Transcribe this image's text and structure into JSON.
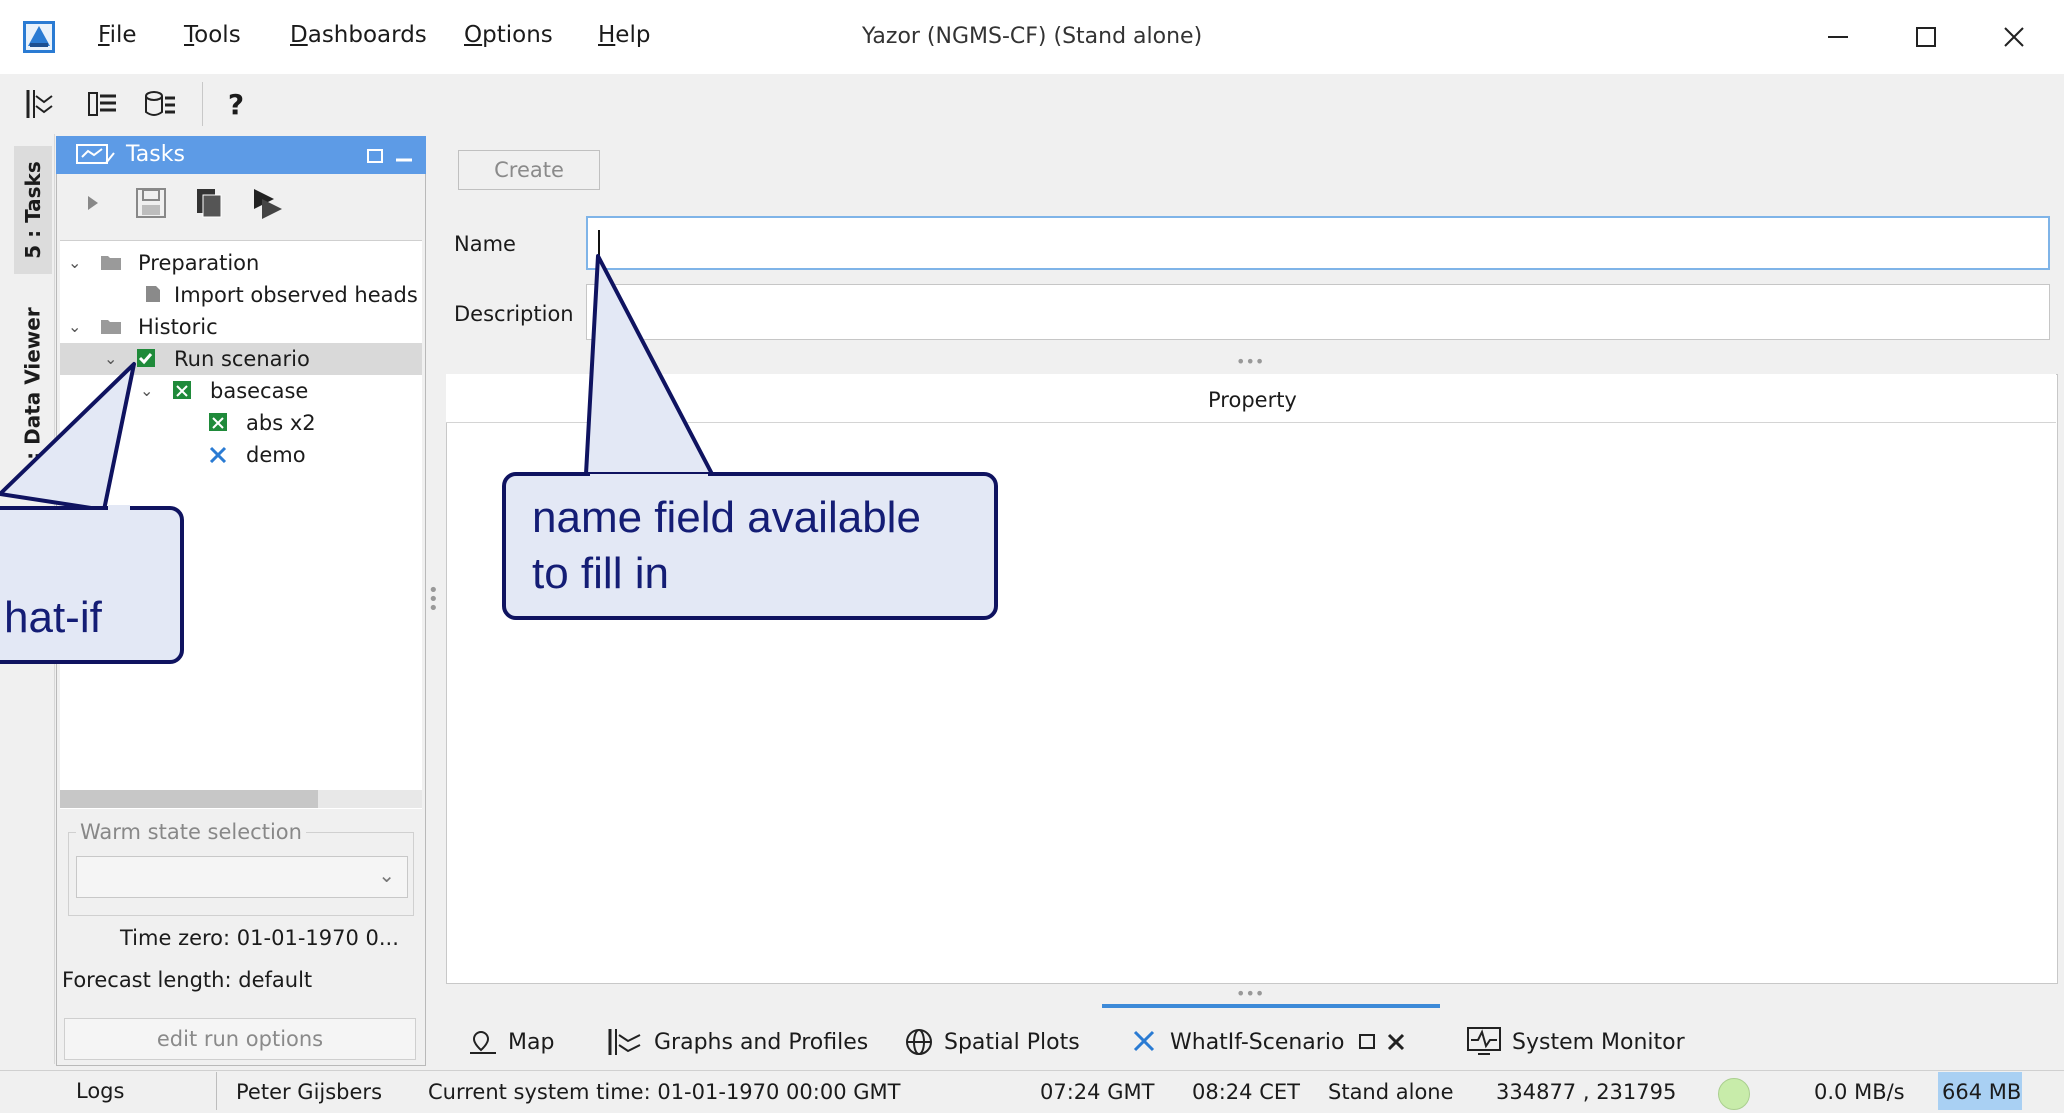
{
  "window": {
    "title": "Yazor (NGMS-CF)  (Stand alone)",
    "menu": [
      "File",
      "Tools",
      "Dashboards",
      "Options",
      "Help"
    ],
    "menu_underlines": [
      "F",
      "T",
      "D",
      "O",
      "H"
    ],
    "controls": [
      "minimize-icon",
      "maximize-icon",
      "close-icon"
    ]
  },
  "toolbar": {
    "help_label": "?"
  },
  "side_tabs": [
    "5 : Tasks",
    "6 : Data Viewer"
  ],
  "tasks": {
    "title": "Tasks",
    "tree": [
      {
        "label": "Preparation",
        "level": 0,
        "expanded": true,
        "icon": "folder-icon"
      },
      {
        "label": "Import observed heads",
        "level": 1,
        "icon": "document-icon"
      },
      {
        "label": "Historic",
        "level": 0,
        "expanded": true,
        "icon": "folder-icon"
      },
      {
        "label": "Run scenario",
        "level": 1,
        "expanded": true,
        "icon": "checkbox-icon",
        "selected": true
      },
      {
        "label": "basecase",
        "level": 2,
        "expanded": true,
        "icon": "scenario-icon"
      },
      {
        "label": "abs x2",
        "level": 3,
        "icon": "scenario-icon"
      },
      {
        "label": "demo",
        "level": 3,
        "icon": "tools-icon"
      }
    ],
    "warm_state_label": "Warm state selection",
    "time_zero_label": "Time zero:",
    "time_zero_value": "01-01-1970 0...",
    "forecast_length_label": "Forecast length:",
    "forecast_length_value": "default",
    "edit_run_label": "edit run options"
  },
  "main": {
    "create_label": "Create",
    "name_label": "Name",
    "name_value": "",
    "description_label": "Description",
    "description_value": "",
    "property_header": "Property"
  },
  "bottom_tabs": [
    {
      "label": "Map",
      "icon": "map-pin-icon"
    },
    {
      "label": "Graphs and Profiles",
      "icon": "graph-icon"
    },
    {
      "label": "Spatial Plots",
      "icon": "globe-icon"
    },
    {
      "label": "WhatIf-Scenario",
      "icon": "tools-icon",
      "active": true
    },
    {
      "label": "System Monitor",
      "icon": "monitor-icon"
    }
  ],
  "statusbar": {
    "logs": "Logs",
    "user": "Peter Gijsbers",
    "system_time": "Current system time: 01-01-1970 00:00 GMT",
    "gmt": "07:24 GMT",
    "cet": "08:24 CET",
    "mode": "Stand alone",
    "coords": "334877 , 231795",
    "status_color": "#c8ecaa",
    "throughput": "0.0 MB/s",
    "memory": "664 MB"
  },
  "callouts": {
    "name_field": "name field available\nto fill in",
    "whatif_fragment": "hat-if"
  },
  "colors": {
    "accent": "#5d9be6",
    "callout_border": "#0f1360",
    "callout_fill": "#e3e8f5"
  }
}
